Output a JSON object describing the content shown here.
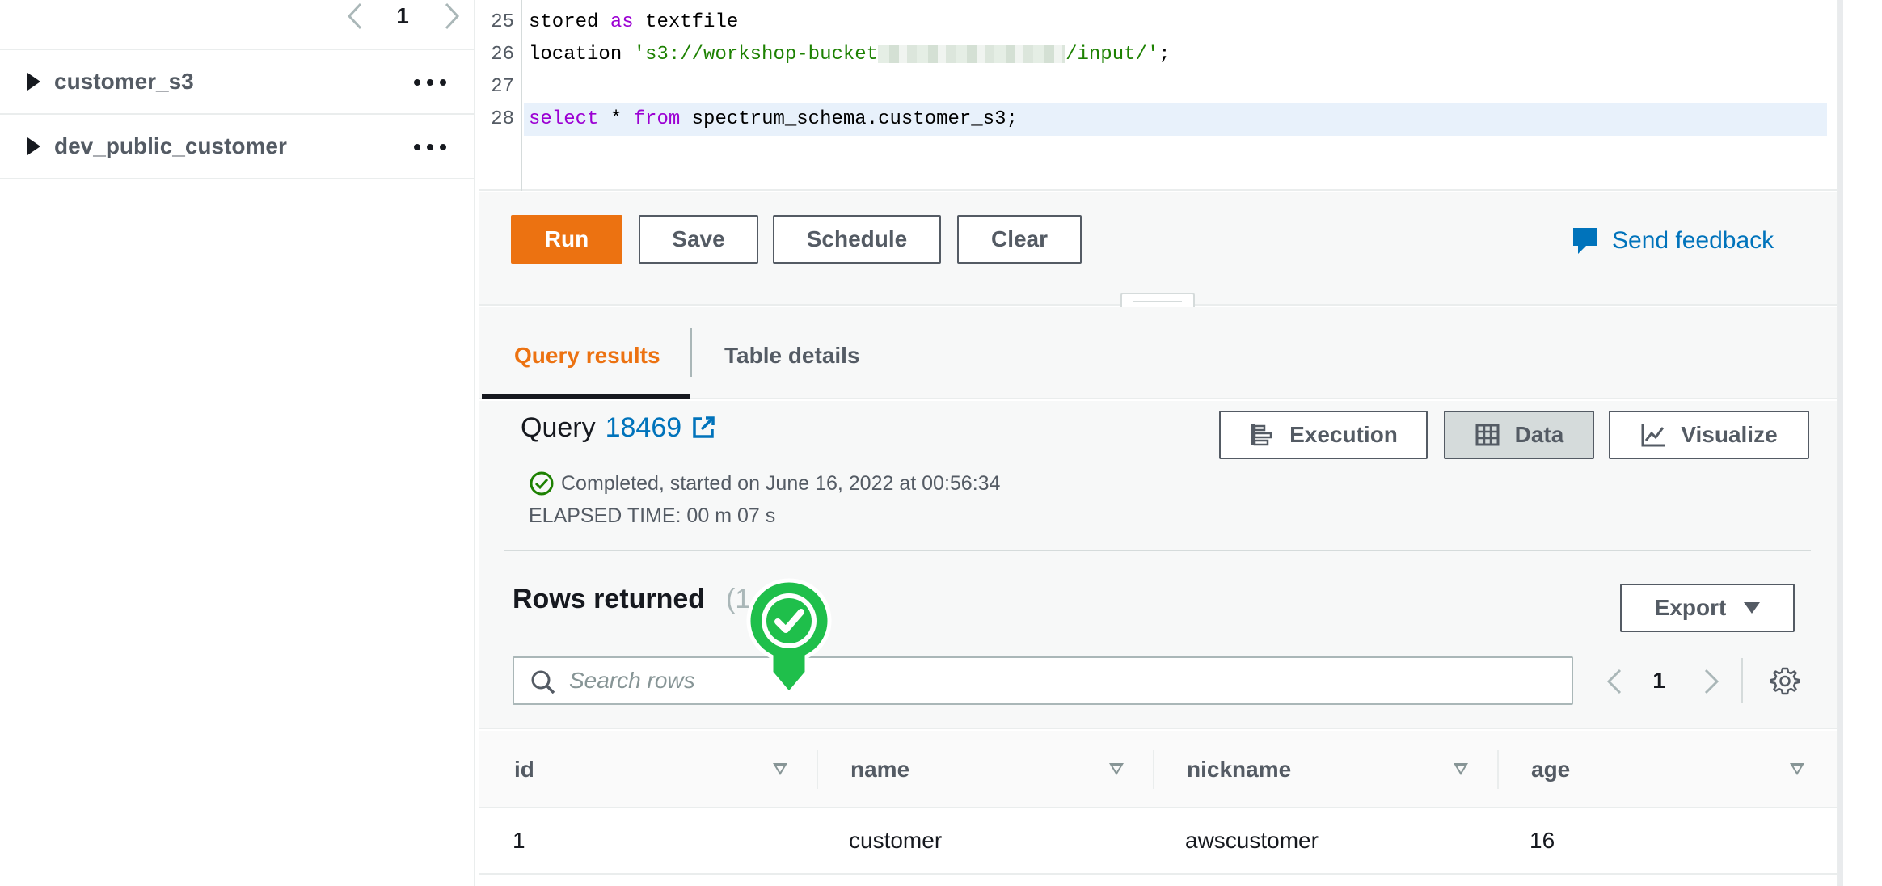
{
  "sidebar": {
    "pager": {
      "page": "1",
      "prev_icon": "chevron-left-icon",
      "next_icon": "chevron-right-icon"
    },
    "tables": [
      {
        "label": "customer_s3"
      },
      {
        "label": "dev_public_customer"
      }
    ]
  },
  "editor": {
    "lines": [
      {
        "num": "25",
        "parts": [
          [
            "stored ",
            ""
          ],
          [
            "as",
            "kw"
          ],
          [
            " textfile",
            ""
          ]
        ]
      },
      {
        "num": "26",
        "parts": [
          [
            "location ",
            ""
          ],
          [
            "'s3://workshop-bucket",
            "str"
          ],
          [
            "__BLUR__",
            "blur"
          ],
          [
            "/input/'",
            "str"
          ],
          [
            ";",
            ""
          ]
        ]
      },
      {
        "num": "27",
        "parts": []
      },
      {
        "num": "28",
        "parts": [
          [
            "select",
            "kw"
          ],
          [
            " * ",
            ""
          ],
          [
            "from",
            "kw"
          ],
          [
            " spectrum_schema.customer_s3;",
            ""
          ]
        ]
      }
    ]
  },
  "toolbar": {
    "run_label": "Run",
    "save_label": "Save",
    "schedule_label": "Schedule",
    "clear_label": "Clear",
    "feedback_label": "Send feedback"
  },
  "tabs": {
    "query_results": "Query results",
    "table_details": "Table details"
  },
  "query": {
    "title": "Query",
    "id": "18469",
    "status": "Completed, started on June 16, 2022 at 00:56:34",
    "elapsed": "ELAPSED TIME: 00 m 07 s",
    "views": {
      "execution": "Execution",
      "data": "Data",
      "visualize": "Visualize"
    }
  },
  "rows": {
    "title": "Rows returned",
    "count": "(1",
    "export_label": "Export",
    "search_placeholder": "Search rows",
    "page": "1"
  },
  "table": {
    "columns": [
      "id",
      "name",
      "nickname",
      "age"
    ],
    "rows": [
      [
        "1",
        "customer",
        "awscustomer",
        "16"
      ]
    ]
  },
  "colors": {
    "accent": "#ec7211",
    "link": "#0073bb",
    "success": "#1d8102",
    "marker": "#1fbf4b"
  }
}
